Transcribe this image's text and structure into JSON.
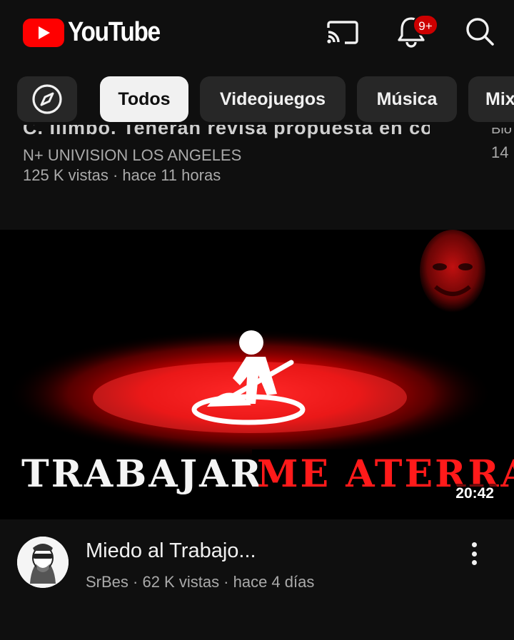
{
  "header": {
    "logo_text": "YouTube",
    "notification_count": "9+",
    "icons": [
      "cast-icon",
      "bell-icon",
      "search-icon"
    ]
  },
  "chips": {
    "explore_icon": "compass-icon",
    "items": [
      {
        "label": "Todos",
        "active": true
      },
      {
        "label": "Videojuegos",
        "active": false
      },
      {
        "label": "Música",
        "active": false
      },
      {
        "label": "Mix",
        "active": false
      }
    ]
  },
  "previous_video": {
    "title_fragment": "C. Ilimbo. Teneran revisa propuesta en comm...",
    "channel": "N+ UNIVISION LOS ANGELES",
    "meta": "125 K vistas · hace 11 horas",
    "right_title_fragment": "Bio",
    "right_meta": "14"
  },
  "video": {
    "thumbnail_text_left": "TRABAJAR",
    "thumbnail_text_right": "ME ATERRA",
    "duration": "20:42",
    "title": "Miedo al Trabajo...",
    "meta": "SrBes · 62 K vistas · hace 4 días",
    "accent_red": "#ff0000"
  }
}
